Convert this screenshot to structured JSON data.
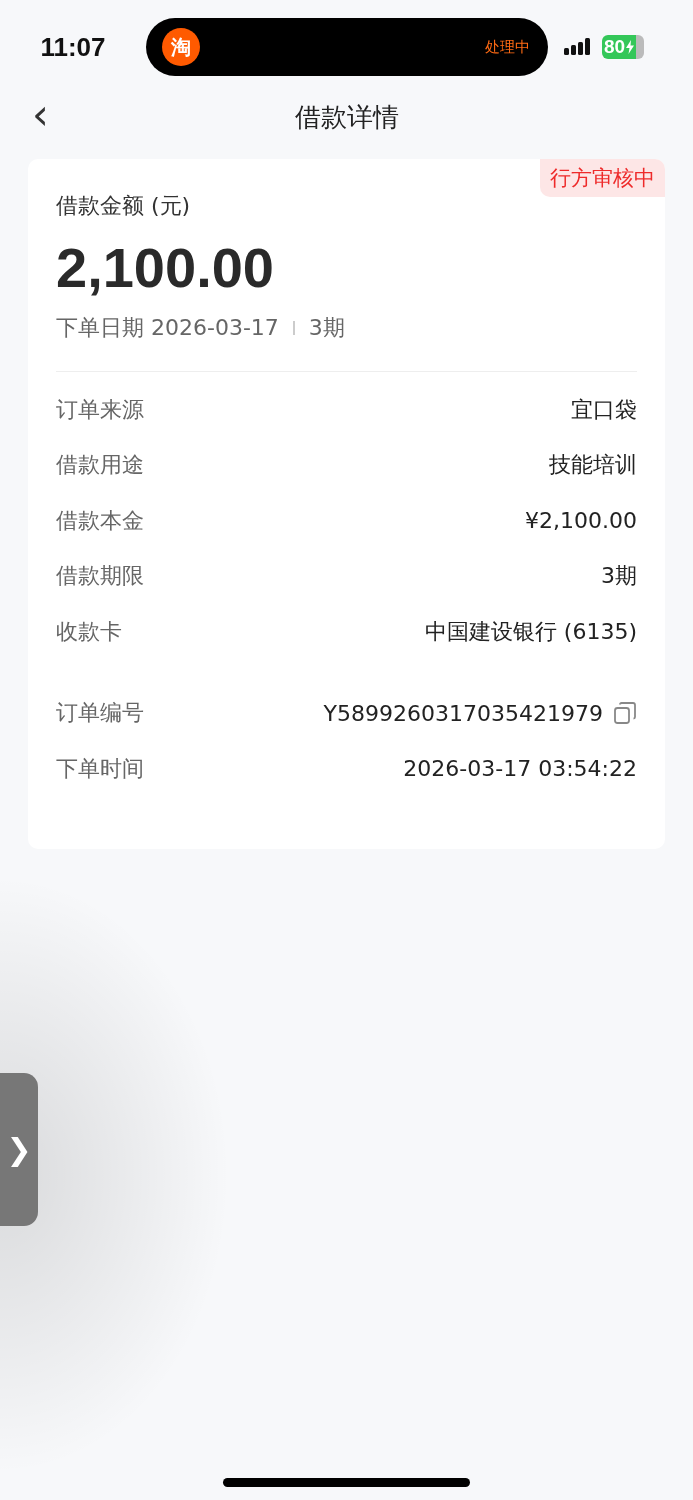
{
  "status_bar": {
    "time": "11:07",
    "island_app_glyph": "淘",
    "island_status": "处理中",
    "battery": "80"
  },
  "nav": {
    "back": "‹",
    "title": "借款详情"
  },
  "summary": {
    "badge": "行方审核中",
    "amount_label": "借款金额 (元)",
    "amount": "2,100.00",
    "date_label": "下单日期 2026-03-17",
    "term": "3期"
  },
  "groups": [
    [
      {
        "label": "订单来源",
        "value": "宜口袋"
      },
      {
        "label": "借款用途",
        "value": "技能培训"
      },
      {
        "label": "借款本金",
        "value": "¥2,100.00"
      },
      {
        "label": "借款期限",
        "value": "3期"
      },
      {
        "label": "收款卡",
        "value": "中国建设银行 (6135)"
      }
    ],
    [
      {
        "label": "订单编号",
        "value": "Y5899260317035421979",
        "copy": true
      },
      {
        "label": "下单时间",
        "value": "2026-03-17 03:54:22",
        "copy": false
      }
    ]
  ],
  "side_handle": {
    "glyph": "❯"
  }
}
